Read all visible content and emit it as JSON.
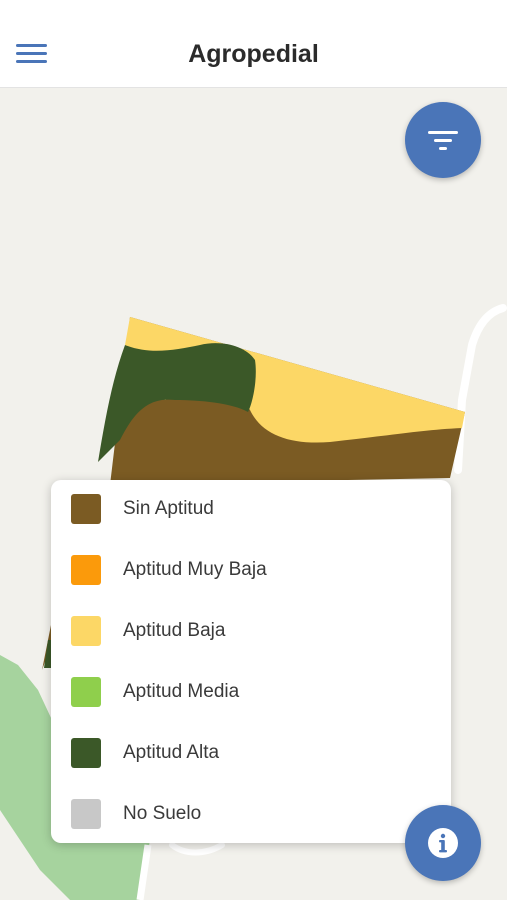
{
  "header": {
    "title": "Agropedial",
    "menu_icon": "hamburger-menu-icon"
  },
  "map": {
    "base_color": "#f2f1ec",
    "road_color": "#ffffff",
    "park_color": "#a6d39e"
  },
  "buttons": {
    "filter_icon": "filter-icon",
    "info_icon": "info-icon",
    "accent_color": "#4a75b8"
  },
  "legend": {
    "items": [
      {
        "label": "Sin Aptitud",
        "color": "#7b5b23"
      },
      {
        "label": "Aptitud Muy Baja",
        "color": "#fb9a0b"
      },
      {
        "label": "Aptitud Baja",
        "color": "#fcd766"
      },
      {
        "label": "Aptitud Media",
        "color": "#8fcf4c"
      },
      {
        "label": "Aptitud Alta",
        "color": "#3b5828"
      },
      {
        "label": "No Suelo",
        "color": "#c8c8c8"
      }
    ]
  }
}
